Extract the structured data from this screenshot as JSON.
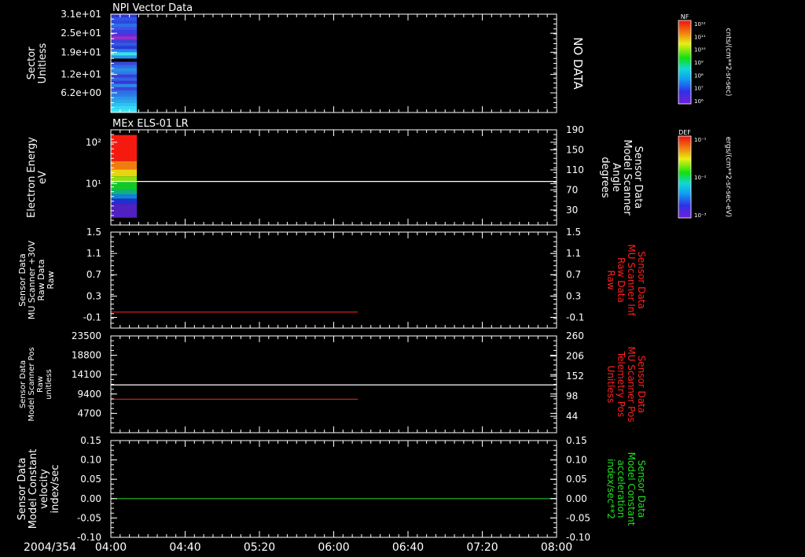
{
  "chart_data": [
    {
      "type": "heatmap",
      "title": "NPI Vector Data",
      "ylabel": [
        "Sector",
        "Unitless"
      ],
      "ylim": [
        0.0,
        31.0
      ],
      "y_ticks": [
        "3.1e+01",
        "2.5e+01",
        "1.9e+01",
        "1.2e+01",
        "6.2e+00"
      ],
      "y_tick_values": [
        31,
        25,
        19,
        12,
        6.2
      ],
      "right_annotation": "NO DATA",
      "colorbar": {
        "label": "NF",
        "unit": "cnts/(cm**2-sr-sec)",
        "ticks": [
          "10¹²",
          "10¹¹",
          "10¹⁰",
          "10⁹",
          "10⁸",
          "10⁷",
          "10⁶"
        ]
      },
      "data_time_range": [
        "04:00",
        "04:14"
      ],
      "rows": [
        {
          "y": 31,
          "color": "#2b37d6"
        },
        {
          "y": 30,
          "color": "#2d57e6"
        },
        {
          "y": 29,
          "color": "#3047dd"
        },
        {
          "y": 28,
          "color": "#2b70e8"
        },
        {
          "y": 27,
          "color": "#4050e8"
        },
        {
          "y": 26,
          "color": "#3a3ee0"
        },
        {
          "y": 25,
          "color": "#5a2ed8"
        },
        {
          "y": 24,
          "color": "#9a2fc8"
        },
        {
          "y": 23,
          "color": "#3e3ed8"
        },
        {
          "y": 22,
          "color": "#2e5ce0"
        },
        {
          "y": 21,
          "color": "#2a3ad8"
        },
        {
          "y": 20,
          "color": "#2a7fe8"
        },
        {
          "y": 19,
          "color": "#38e0f0"
        },
        {
          "y": 18,
          "color": "#2a98e8"
        },
        {
          "y": 17,
          "color": "#000000"
        },
        {
          "y": 16,
          "color": "#3a48d8"
        },
        {
          "y": 15,
          "color": "#2e6ee4"
        },
        {
          "y": 14,
          "color": "#2a8ee8"
        },
        {
          "y": 13,
          "color": "#2c7ce6"
        },
        {
          "y": 12,
          "color": "#3a3ed8"
        },
        {
          "y": 11,
          "color": "#2e64e2"
        },
        {
          "y": 10,
          "color": "#3a36d4"
        },
        {
          "y": 9,
          "color": "#2c88e8"
        },
        {
          "y": 8,
          "color": "#3c44d8"
        },
        {
          "y": 7,
          "color": "#2e6ee4"
        },
        {
          "y": 6,
          "color": "#2a7ce8"
        },
        {
          "y": 5,
          "color": "#2c96e8"
        },
        {
          "y": 4,
          "color": "#2aa8ec"
        },
        {
          "y": 3,
          "color": "#30c0f0"
        },
        {
          "y": 2,
          "color": "#36d8f4"
        },
        {
          "y": 1,
          "color": "#3ee4f6"
        }
      ]
    },
    {
      "type": "heatmap",
      "title": "MEx ELS-01 LR",
      "ylabel": [
        "Electron Energy",
        "eV"
      ],
      "y_scale": "log",
      "ylim": [
        1,
        200
      ],
      "y_ticks": [
        "10²",
        "10¹"
      ],
      "y_tick_values": [
        100,
        10
      ],
      "right_axis": {
        "label": [
          "Sensor Data",
          "Model Scanner",
          "Angle",
          "degrees"
        ],
        "ylim": [
          0,
          190
        ],
        "ticks": [
          "190",
          "150",
          "110",
          "70",
          "30"
        ],
        "tick_values": [
          190,
          150,
          110,
          70,
          30
        ]
      },
      "colorbar": {
        "label": "DEF",
        "unit": "ergs/(cm**2-sr-sec-eV)",
        "ticks": [
          "10⁻¹",
          "10⁻²",
          "10⁻³"
        ]
      },
      "data_time_range": [
        "04:00",
        "04:14"
      ],
      "bands": [
        {
          "from": 150,
          "to": 35,
          "color": "#f51a10"
        },
        {
          "from": 35,
          "to": 22,
          "color": "#f07c10"
        },
        {
          "from": 22,
          "to": 15,
          "color": "#e8d410"
        },
        {
          "from": 15,
          "to": 11,
          "color": "#8ce010"
        },
        {
          "from": 11,
          "to": 7,
          "color": "#10c828"
        },
        {
          "from": 7,
          "to": 5.5,
          "color": "#10b080"
        },
        {
          "from": 5.5,
          "to": 4.3,
          "color": "#1080e0"
        },
        {
          "from": 4.3,
          "to": 3.2,
          "color": "#2030d0"
        },
        {
          "from": 3.2,
          "to": 1.5,
          "color": "#5020c0"
        }
      ],
      "line_right_axis": {
        "value": 87,
        "color": "#ffffff"
      }
    },
    {
      "type": "line",
      "ylabel": [
        "Sensor Data",
        "MU Scanner +30V",
        "Raw Data",
        "Raw"
      ],
      "ylim": [
        -0.3,
        1.5
      ],
      "y_ticks": [
        "1.5",
        "1.1",
        "0.7",
        "0.3",
        "-0.1"
      ],
      "y_tick_values": [
        1.5,
        1.1,
        0.7,
        0.3,
        -0.1
      ],
      "right_axis": {
        "label": [
          "Sensor Data",
          "MU Scanner Inf",
          "Raw Data",
          "Raw"
        ],
        "label_color": "#ff2020",
        "ylim": [
          -0.3,
          1.5
        ],
        "ticks": [
          "1.5",
          "1.1",
          "0.7",
          "0.3",
          "-0.1"
        ],
        "tick_values": [
          1.5,
          1.1,
          0.7,
          0.3,
          -0.1
        ]
      },
      "series": [
        {
          "axis": "right",
          "color": "#e02020",
          "x": [
            "04:00",
            "06:13"
          ],
          "y": [
            0.0,
            0.0
          ]
        }
      ]
    },
    {
      "type": "line",
      "ylabel": [
        "Sensor Data",
        "Model Scanner Pos",
        "Raw",
        "unitless"
      ],
      "ylim": [
        0,
        23500
      ],
      "y_ticks": [
        "23500",
        "18800",
        "14100",
        "9400",
        "4700"
      ],
      "y_tick_values": [
        23500,
        18800,
        14100,
        9400,
        4700
      ],
      "right_axis": {
        "label": [
          "Sensor Data",
          "MU Scanner Pos",
          "Telemetry Pos",
          "Unitless"
        ],
        "label_color": "#ff2020",
        "ylim": [
          0,
          260
        ],
        "ticks": [
          "260",
          "206",
          "152",
          "98",
          "44"
        ],
        "tick_values": [
          260,
          206,
          152,
          98,
          44
        ]
      },
      "series": [
        {
          "axis": "left",
          "color": "#ffffff",
          "x": [
            "04:00",
            "08:00"
          ],
          "y": [
            11600,
            11600
          ]
        },
        {
          "axis": "right",
          "color": "#e02020",
          "x": [
            "04:00",
            "06:13"
          ],
          "y": [
            90,
            90
          ]
        }
      ]
    },
    {
      "type": "line",
      "ylabel": [
        "Sensor Data",
        "Model Constant",
        "velocity",
        "index/sec"
      ],
      "ylim": [
        -0.1,
        0.15
      ],
      "y_ticks": [
        "0.15",
        "0.10",
        "0.05",
        "0.00",
        "-0.05",
        "-0.10"
      ],
      "y_tick_values": [
        0.15,
        0.1,
        0.05,
        0.0,
        -0.05,
        -0.1
      ],
      "right_axis": {
        "label": [
          "Sensor Data",
          "Model Constant",
          "acceleration",
          "index/sec**2"
        ],
        "label_color": "#20e020",
        "ylim": [
          -0.1,
          0.15
        ],
        "ticks": [
          "0.15",
          "0.10",
          "0.05",
          "0.00",
          "-0.05",
          "-0.10"
        ],
        "tick_values": [
          0.15,
          0.1,
          0.05,
          0.0,
          -0.05,
          -0.1
        ]
      },
      "series": [
        {
          "axis": "left",
          "color": "#20c020",
          "x": [
            "04:00",
            "08:00"
          ],
          "y": [
            0.0,
            0.0
          ]
        }
      ]
    }
  ],
  "x_axis": {
    "date_label": "2004/354",
    "range": [
      "04:00",
      "08:00"
    ],
    "ticks": [
      "04:00",
      "04:40",
      "05:20",
      "06:00",
      "06:40",
      "07:20",
      "08:00"
    ]
  }
}
